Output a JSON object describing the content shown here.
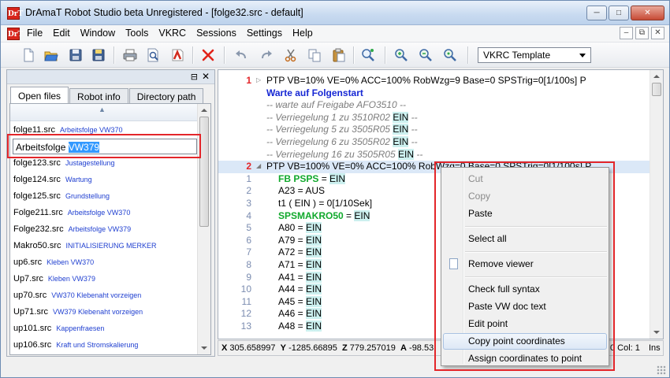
{
  "window": {
    "title": "DrAmaT Robot Studio beta Unregistered  - [folge32.src - default]",
    "app_icon_text": "DrT",
    "controls": [
      "minimize",
      "maximize",
      "close"
    ]
  },
  "menu": {
    "items": [
      "File",
      "Edit",
      "Window",
      "Tools",
      "VKRC",
      "Sessions",
      "Settings",
      "Help"
    ]
  },
  "toolbar": {
    "template_select_value": "VKRC Template",
    "icons": [
      "new-file-icon",
      "open-file-icon",
      "save-icon",
      "save-all-icon",
      "print-icon",
      "print-preview-icon",
      "pdf-export-icon",
      "delete-icon",
      "undo-icon",
      "redo-icon",
      "cut-icon",
      "copy-icon",
      "paste-icon",
      "find-icon",
      "zoom-in-icon",
      "zoom-out-icon",
      "zoom-reset-icon"
    ]
  },
  "left_panel": {
    "tabs": [
      {
        "label": "Open files",
        "active": true
      },
      {
        "label": "Robot info",
        "active": false
      },
      {
        "label": "Directory path",
        "active": false
      }
    ],
    "files": [
      {
        "name": "folge11.src",
        "desc": "Arbeitsfolge VW370"
      },
      {
        "name": "Arbeitsfolge ",
        "selected": "VW379",
        "editing": true
      },
      {
        "name": "folge123.src",
        "desc": "Justagestellung"
      },
      {
        "name": "folge124.src",
        "desc": "Wartung"
      },
      {
        "name": "folge125.src",
        "desc": "Grundstellung"
      },
      {
        "name": "Folge211.src",
        "desc": "Arbeitsfolge VW370"
      },
      {
        "name": "Folge232.src",
        "desc": "Arbeitsfolge VW379"
      },
      {
        "name": "Makro50.src",
        "desc": "INITIALISIERUNG MERKER"
      },
      {
        "name": "up6.src",
        "desc": "Kleben VW370"
      },
      {
        "name": "Up7.src",
        "desc": "Kleben VW379"
      },
      {
        "name": "up70.src",
        "desc": "VW370 Klebenaht vorzeigen"
      },
      {
        "name": "Up71.src",
        "desc": "VW379 Klebenaht vorzeigen"
      },
      {
        "name": "up101.src",
        "desc": "Kappenfraesen"
      },
      {
        "name": "up106.src",
        "desc": "Kraft und Stromskalierung"
      }
    ]
  },
  "editor": {
    "lines": [
      {
        "ln": "1",
        "red": true,
        "fold": "▷",
        "style": "",
        "text": "PTP VB=10% VE=0% ACC=100% RobWzg=9 Base=0 SPSTrig=0[1/100s] P"
      },
      {
        "ln": "",
        "style": "blue",
        "text": "Warte auf Folgenstart"
      },
      {
        "ln": "",
        "style": "cmt",
        "text": "-- warte auf Freigabe AFO3510 --"
      },
      {
        "ln": "",
        "style": "cmt",
        "text": "-- Verriegelung 1 zu 3510R02 ",
        "ein": "EIN",
        "tail": " --"
      },
      {
        "ln": "",
        "style": "cmt",
        "text": "-- Verriegelung 5 zu 3505R05 ",
        "ein": "EIN",
        "tail": " --"
      },
      {
        "ln": "",
        "style": "cmt",
        "text": "-- Verriegelung 6 zu 3505R02 ",
        "ein": "EIN",
        "tail": " --"
      },
      {
        "ln": "",
        "style": "cmt",
        "text": "-- Verriegelung 16 zu 3505R05 ",
        "ein": "EIN",
        "tail": " --"
      },
      {
        "ln": "2",
        "red": true,
        "fold": "◢",
        "style": "",
        "current": true,
        "text": "PTP VB=100% VE=0% ACC=100% RobWzg=0 Base=0 SPSTrig=0[1/100s] P"
      },
      {
        "ln": "1",
        "style": "green",
        "indent": true,
        "text": "FB PSPS",
        "plain": " = ",
        "ein": "EIN"
      },
      {
        "ln": "2",
        "style": "",
        "indent": true,
        "text": "A23 = AUS"
      },
      {
        "ln": "3",
        "style": "",
        "indent": true,
        "text": "t1 ( EIN ) = 0[1/10Sek]"
      },
      {
        "ln": "4",
        "style": "green",
        "indent": true,
        "text": "SPSMAKRO50",
        "plain": " = ",
        "ein": "EIN"
      },
      {
        "ln": "5",
        "style": "",
        "indent": true,
        "text": "A80 = ",
        "ein": "EIN"
      },
      {
        "ln": "6",
        "style": "",
        "indent": true,
        "text": "A79 = ",
        "ein": "EIN"
      },
      {
        "ln": "7",
        "style": "",
        "indent": true,
        "text": "A72 = ",
        "ein": "EIN"
      },
      {
        "ln": "8",
        "style": "",
        "indent": true,
        "text": "A71 = ",
        "ein": "EIN"
      },
      {
        "ln": "9",
        "style": "",
        "indent": true,
        "text": "A41 = ",
        "ein": "EIN"
      },
      {
        "ln": "10",
        "style": "",
        "indent": true,
        "text": "A44 = ",
        "ein": "EIN"
      },
      {
        "ln": "11",
        "style": "",
        "indent": true,
        "text": "A45 = ",
        "ein": "EIN"
      },
      {
        "ln": "12",
        "style": "",
        "indent": true,
        "text": "A46 = ",
        "ein": "EIN"
      },
      {
        "ln": "13",
        "style": "",
        "indent": true,
        "text": "A48 = ",
        "ein": "EIN"
      }
    ]
  },
  "status": {
    "x_label": "X",
    "x_value": "305.658997",
    "y_label": "Y",
    "y_value": "-1285.66895",
    "z_label": "Z",
    "z_value": "779.257019",
    "a_label": "A",
    "a_value": "-98.53",
    "col": "0 Col: 1",
    "mode": "Ins"
  },
  "context_menu": {
    "items": [
      {
        "label": "Cut",
        "disabled": true
      },
      {
        "label": "Copy",
        "disabled": true
      },
      {
        "label": "Paste"
      },
      {
        "sep": true
      },
      {
        "label": "Select all"
      },
      {
        "sep": true
      },
      {
        "label": "Remove viewer",
        "icon": true
      },
      {
        "sep": true
      },
      {
        "label": "Check full syntax"
      },
      {
        "label": "Paste VW doc text"
      },
      {
        "label": "Edit point"
      },
      {
        "label": "Copy point coordinates",
        "hover": true
      },
      {
        "label": "Assign coordinates to point"
      }
    ]
  },
  "colors": {
    "highlight_box": "#e3262a",
    "keyword_blue": "#1728d4",
    "macro_green": "#11a92c",
    "ein_highlight": "#ccf0ef",
    "description_blue": "#1f3fd0"
  }
}
